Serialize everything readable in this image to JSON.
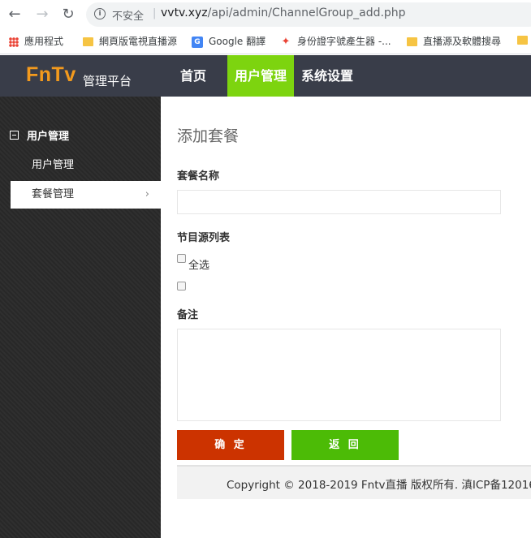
{
  "browser": {
    "not_secure": "不安全",
    "separator": "|",
    "url_host": "vvtv.xyz",
    "url_path": "/api/admin/ChannelGroup_add.php",
    "bookmarks": [
      {
        "label": "應用程式",
        "icon": "apps-grid-icon"
      },
      {
        "label": "網頁版電視直播源",
        "icon": "folder-icon"
      },
      {
        "label": "Google 翻譯",
        "icon": "google-translate-icon"
      },
      {
        "label": "身份證字號產生器 -...",
        "icon": "pinwheel-icon"
      },
      {
        "label": "直播源及軟體搜尋",
        "icon": "folder-icon"
      }
    ]
  },
  "header": {
    "logo": "FnTv",
    "logo_sub": "管理平台",
    "nav": [
      {
        "label": "首页",
        "active": false
      },
      {
        "label": "用户管理",
        "active": true
      },
      {
        "label": "系统设置",
        "active": false
      }
    ]
  },
  "sidebar": {
    "section_title": "用户管理",
    "items": [
      {
        "label": "用户管理",
        "active": false
      },
      {
        "label": "套餐管理",
        "active": true,
        "chevron": "›"
      }
    ]
  },
  "main": {
    "title": "添加套餐",
    "package_name_label": "套餐名称",
    "package_name_value": "",
    "channel_list_label": "节目源列表",
    "select_all_label": "全选",
    "remark_label": "备注",
    "remark_value": "",
    "confirm_button": "确 定",
    "back_button": "返 回"
  },
  "footer": {
    "copyright": "Copyright © 2018-2019 Fntv直播 版权所有. 滇ICP备12016"
  },
  "colors": {
    "nav_bg": "#393d49",
    "nav_active": "#7dd40f",
    "logo": "#f39a1d",
    "confirm": "#cc3300",
    "back": "#4cbb06"
  }
}
